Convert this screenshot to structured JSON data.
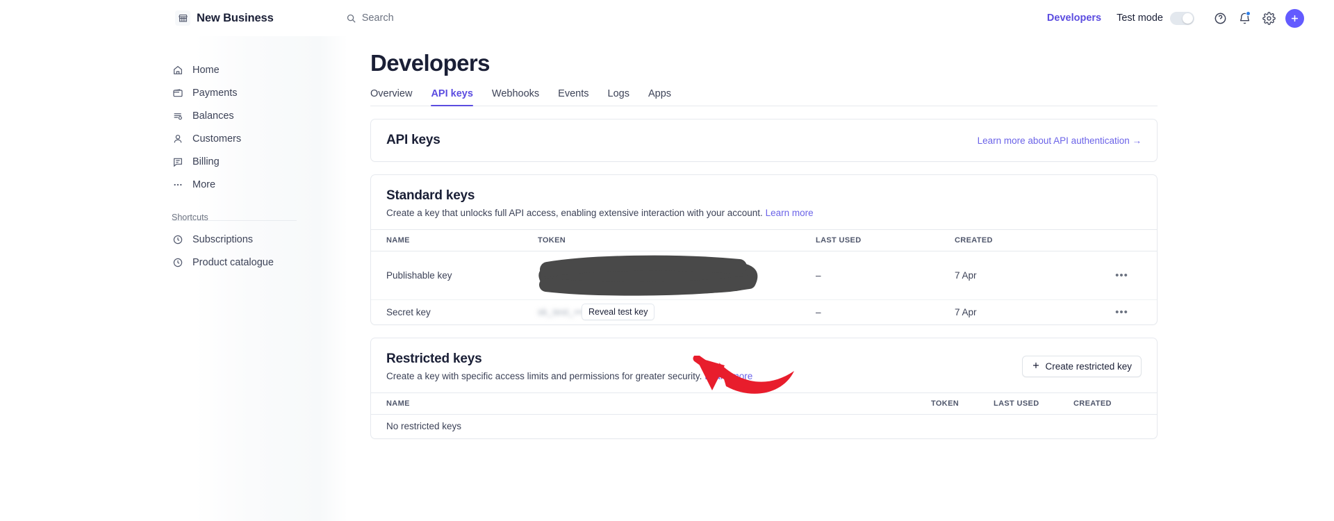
{
  "topbar": {
    "account_name": "New Business",
    "account_icon": "storefront-icon",
    "search": {
      "placeholder": "Search",
      "icon": "search-icon"
    },
    "developers_link": "Developers",
    "test_mode": {
      "label": "Test mode",
      "enabled": false
    },
    "icons": [
      {
        "name": "help-icon",
        "glyph": "?"
      },
      {
        "name": "notifications-icon",
        "glyph": "bell",
        "badge": true
      },
      {
        "name": "settings-icon",
        "glyph": "gear"
      }
    ],
    "add_button": {
      "name": "add-button",
      "glyph": "+"
    },
    "accent_color": "#635bff",
    "link_color": "#5b4ce0"
  },
  "sidebar": {
    "items": [
      {
        "label": "Home",
        "icon": "home-icon"
      },
      {
        "label": "Payments",
        "icon": "wallet-icon"
      },
      {
        "label": "Balances",
        "icon": "balances-icon"
      },
      {
        "label": "Customers",
        "icon": "person-icon"
      },
      {
        "label": "Billing",
        "icon": "billing-icon"
      },
      {
        "label": "More",
        "icon": "ellipsis-icon"
      }
    ],
    "shortcuts_heading": "Shortcuts",
    "shortcuts": [
      {
        "label": "Subscriptions",
        "icon": "clock-icon"
      },
      {
        "label": "Product catalogue",
        "icon": "clock-icon"
      }
    ]
  },
  "main": {
    "page_title": "Developers",
    "tabs": [
      {
        "label": "Overview",
        "active": false
      },
      {
        "label": "API keys",
        "active": true
      },
      {
        "label": "Webhooks",
        "active": false
      },
      {
        "label": "Events",
        "active": false
      },
      {
        "label": "Logs",
        "active": false
      },
      {
        "label": "Apps",
        "active": false
      }
    ],
    "api_keys_card": {
      "title": "API keys",
      "learn_link": "Learn more about API authentication →"
    },
    "standard_keys": {
      "title": "Standard keys",
      "description": "Create a key that unlocks full API access, enabling extensive interaction with your account.",
      "learn_more": "Learn more",
      "columns": [
        "NAME",
        "TOKEN",
        "LAST USED",
        "CREATED"
      ],
      "rows": [
        {
          "name": "Publishable key",
          "token": "",
          "token_state": "redacted",
          "last_used": "–",
          "created": "7 Apr",
          "actions": "•••"
        },
        {
          "name": "Secret key",
          "token": "sk_test_••••••••••••",
          "token_state": "hidden",
          "reveal_label": "Reveal test key",
          "last_used": "–",
          "created": "7 Apr",
          "actions": "•••"
        }
      ]
    },
    "restricted_keys": {
      "title": "Restricted keys",
      "description": "Create a key with specific access limits and permissions for greater security.",
      "learn_more": "Learn more",
      "create_button": "Create restricted key",
      "create_icon": "plus-icon",
      "columns": [
        "NAME",
        "TOKEN",
        "LAST USED",
        "CREATED"
      ],
      "empty_text": "No restricted keys"
    }
  },
  "annotations": {
    "arrow": {
      "name": "red-arrow-annotation",
      "color": "#e81d2c"
    },
    "redaction": {
      "name": "black-redaction-scribble",
      "color": "#494949"
    }
  }
}
